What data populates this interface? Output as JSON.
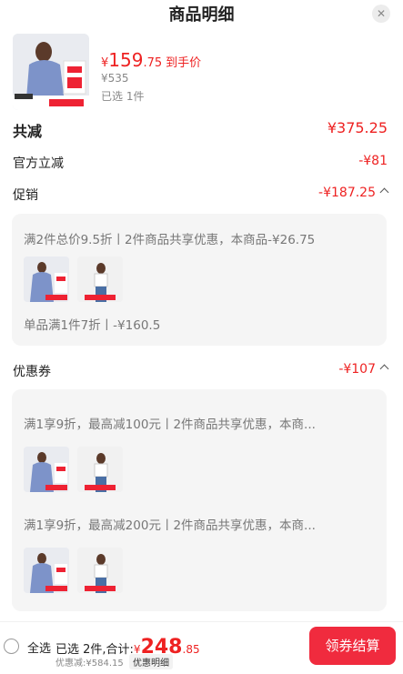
{
  "header": {
    "title": "商品明细",
    "close_glyph": "✕"
  },
  "product": {
    "price_symbol": "¥",
    "price_int": "159",
    "price_dec": ".75",
    "price_tag": "到手价",
    "original_price": "¥535",
    "selected": "已选 1件"
  },
  "summary": {
    "total_label": "共减",
    "total_value": "¥375.25",
    "official_label": "官方立减",
    "official_value": "-¥81"
  },
  "promo": {
    "label": "促销",
    "value": "-¥187.25",
    "rule1": "满2件总价9.5折丨2件商品共享优惠，本商品-¥26.75",
    "rule2": "单品满1件7折丨-¥160.5"
  },
  "coupon": {
    "label": "优惠券",
    "value": "-¥107",
    "rule1": "满1享9折，最高减100元丨2件商品共享优惠，本商...",
    "rule2": "满1享9折，最高减200元丨2件商品共享优惠，本商..."
  },
  "footer": {
    "select_all": "全选",
    "selected_text": "已选 2件,合计:",
    "total_symbol": "¥",
    "total_int": "248",
    "total_dec": ".85",
    "discount": "优惠减:¥584.15",
    "detail_btn": "优惠明细",
    "checkout_btn": "领券结算"
  },
  "colors": {
    "accent": "#ee2222",
    "button": "#f02b3e",
    "card_bg": "#f5f5f5"
  }
}
